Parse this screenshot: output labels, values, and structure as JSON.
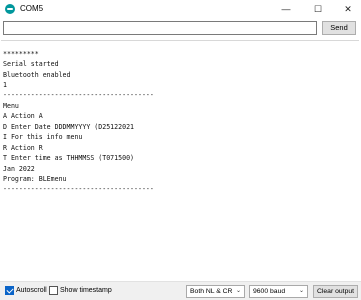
{
  "window": {
    "title": "COM5",
    "minimize_glyph": "—",
    "maximize_glyph": "☐",
    "close_glyph": "✕"
  },
  "send": {
    "input_value": "",
    "input_placeholder": "",
    "button_label": "Send"
  },
  "output": {
    "lines": [
      "*********",
      "Serial started",
      "Bluetooth enabled",
      "1",
      "--------------------------------------",
      "Menu",
      "A Action A",
      "D Enter Date DDDMMYYYY (D25122021",
      "I For this info menu",
      "R Action R",
      "T Enter time as THHMMSS (T071500)",
      "Jan 2022",
      "Program: BLEmenu",
      "--------------------------------------"
    ]
  },
  "bottom": {
    "autoscroll_label": "Autoscroll",
    "autoscroll_checked": true,
    "timestamp_label": "Show timestamp",
    "timestamp_checked": false,
    "line_ending": "Both NL & CR",
    "baud": "9600 baud",
    "clear_label": "Clear output",
    "chevron_glyph": "⌄"
  },
  "colors": {
    "accent": "#0a64c8",
    "logo": "#00979c"
  }
}
